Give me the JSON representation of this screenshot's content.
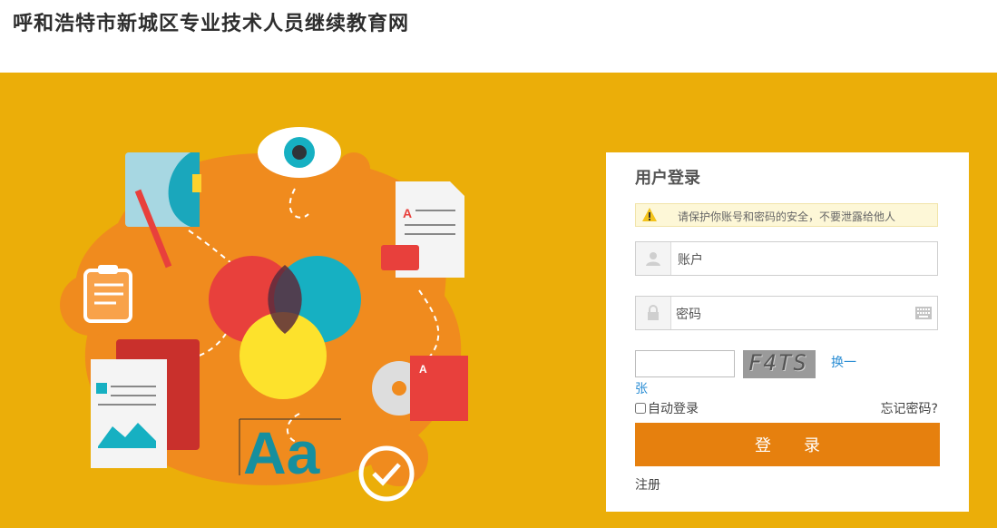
{
  "header": {
    "title": "呼和浩特市新城区专业技术人员继续教育网"
  },
  "banner": {
    "background": "#ebae09",
    "art_letters": "Aa",
    "art_doc_letter": "A"
  },
  "login": {
    "title": "用户登录",
    "warning": "请保护你账号和密码的安全，不要泄露给他人",
    "account_placeholder": "账户",
    "password_placeholder": "密码",
    "captcha_text": "F4TS",
    "refresh_part1": "换一",
    "refresh_part2": "张",
    "remember_label": "自动登录",
    "forgot_label": "忘记密码?",
    "submit_label": "登录",
    "register_label": "注册",
    "accent": "#e6800e"
  }
}
